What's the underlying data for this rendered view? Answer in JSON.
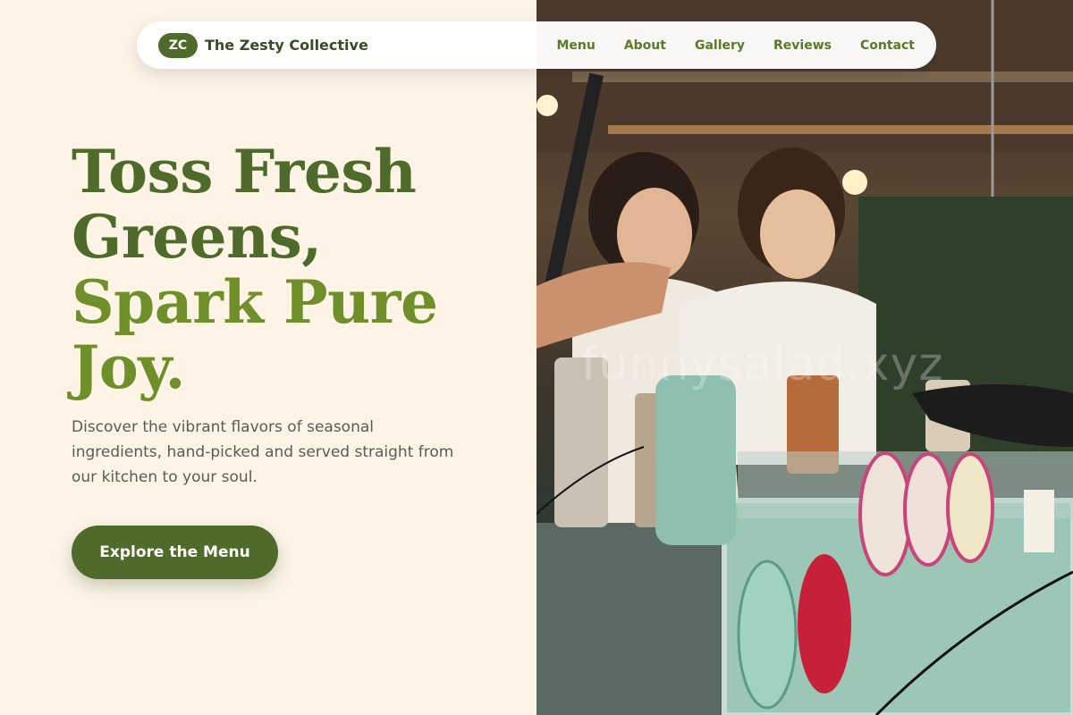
{
  "nav": {
    "logo_initials": "ZC",
    "brand": "The Zesty Collective",
    "links": [
      "Menu",
      "About",
      "Gallery",
      "Reviews",
      "Contact"
    ]
  },
  "hero": {
    "headline_line1": "Toss Fresh Greens,",
    "headline_line2": "Spark Pure Joy.",
    "subtext": "Discover the vibrant flavors of seasonal ingredients, hand-picked and served straight from our kitchen to your soul.",
    "cta_label": "Explore the Menu"
  },
  "photo": {
    "watermark": "funnysalad.xyz"
  },
  "colors": {
    "background": "#fdf4e6",
    "primary": "#4e6b2b",
    "accent": "#6e8f2a",
    "text_muted": "#5b5b56"
  }
}
